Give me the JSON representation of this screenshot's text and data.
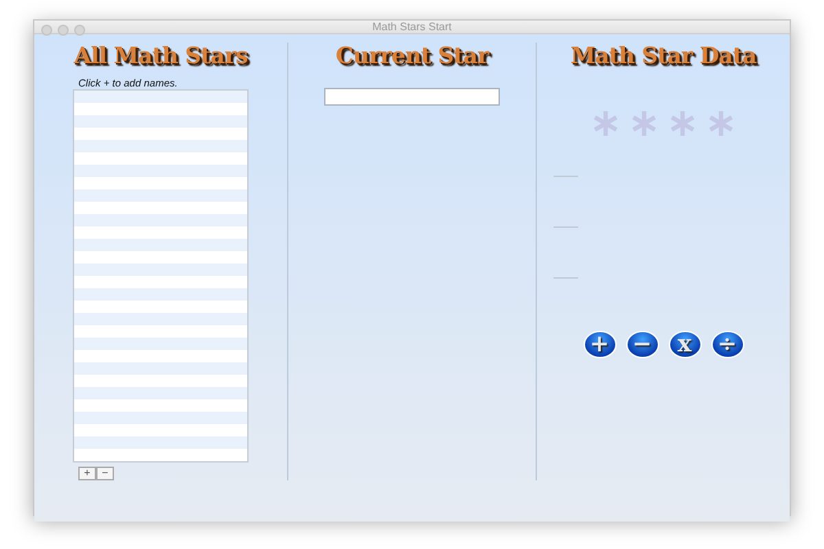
{
  "window": {
    "title": "Math Stars Start"
  },
  "all_stars": {
    "heading": "All Math Stars",
    "hint": "Click + to add names.",
    "buttons": [
      "+",
      "−"
    ]
  },
  "current_star": {
    "heading": "Current Star"
  },
  "star_data": {
    "heading": "Math Star Data",
    "operations": [
      "+",
      "−",
      "x",
      "÷"
    ]
  }
}
